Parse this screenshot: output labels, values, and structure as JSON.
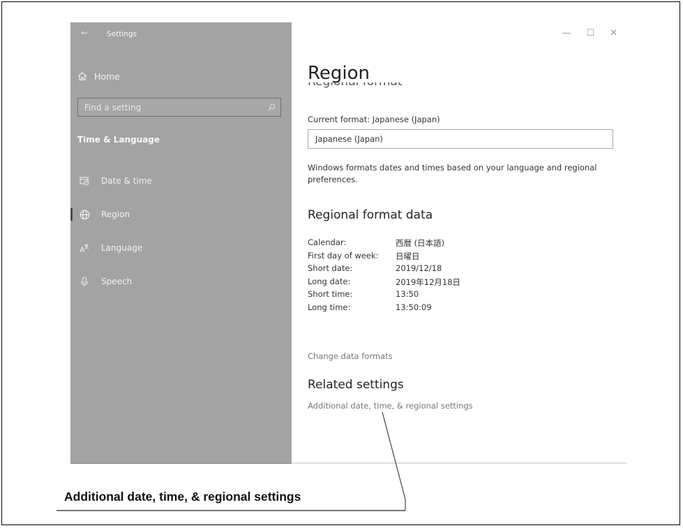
{
  "window": {
    "app_title": "Settings",
    "back_glyph": "←",
    "controls": {
      "minimize": "—",
      "maximize": "☐",
      "close": "✕"
    }
  },
  "sidebar": {
    "home_label": "Home",
    "search_placeholder": "Find a setting",
    "section_title": "Time & Language",
    "items": [
      {
        "label": "Date & time",
        "icon": "calendar-clock-icon",
        "active": false
      },
      {
        "label": "Region",
        "icon": "globe-icon",
        "active": true
      },
      {
        "label": "Language",
        "icon": "language-icon",
        "active": false
      },
      {
        "label": "Speech",
        "icon": "microphone-icon",
        "active": false
      }
    ]
  },
  "main": {
    "page_title": "Region",
    "cut_heading": "Regional format",
    "current_format_label": "Current format: Japanese (Japan)",
    "format_value": "Japanese (Japan)",
    "description": "Windows formats dates and times based on your language and regional preferences.",
    "format_data_heading": "Regional format data",
    "format_data": [
      {
        "key": "Calendar:",
        "value": "西暦 (日本語)"
      },
      {
        "key": "First day of week:",
        "value": "日曜日"
      },
      {
        "key": "Short date:",
        "value": "2019/12/18"
      },
      {
        "key": "Long date:",
        "value": "2019年12月18日"
      },
      {
        "key": "Short time:",
        "value": "13:50"
      },
      {
        "key": "Long time:",
        "value": "13:50:09"
      }
    ],
    "change_formats_link": "Change data formats",
    "related_heading": "Related settings",
    "related_link": "Additional date, time, & regional settings"
  },
  "callout": {
    "text": "Additional date, time, & regional settings"
  }
}
